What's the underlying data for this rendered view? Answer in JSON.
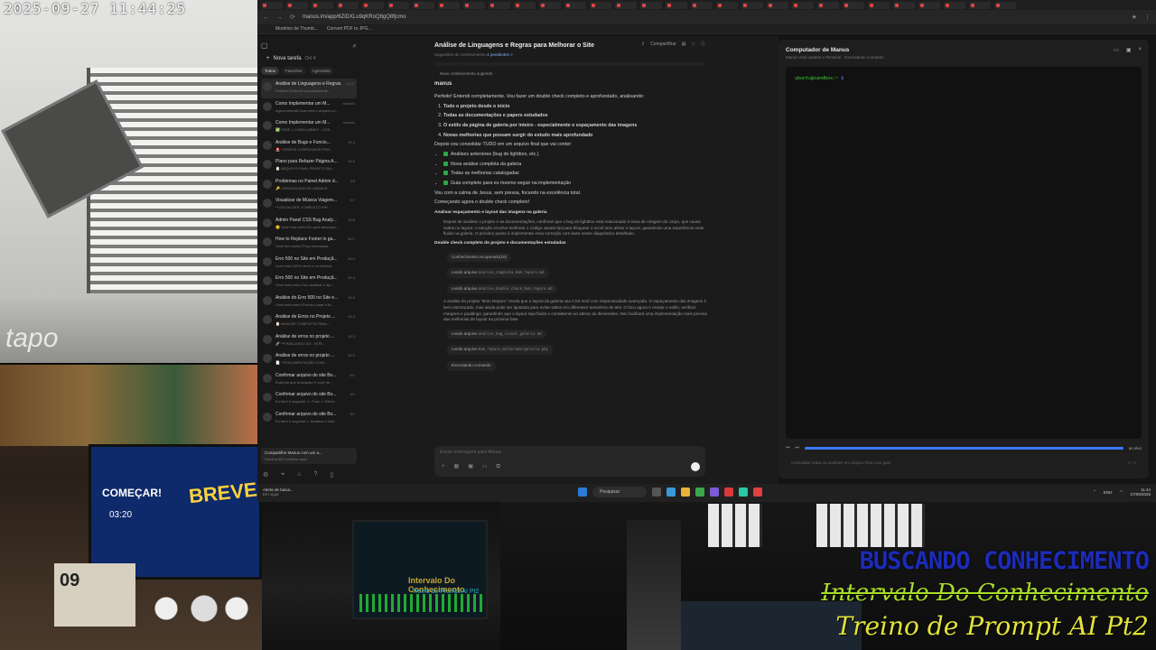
{
  "overlay": {
    "cam_timestamp": "2025-09-27  11:44:25",
    "cam_brand": "tapo",
    "line1": "BUSCANDO CONHECIMENTO",
    "line2": "Intervalo Do Conhecimento",
    "line3": "Treino de Prompt AI Pt2"
  },
  "webcam_monitor": {
    "text_comecar": "COMEÇAR!",
    "text_time": "03:20",
    "text_breve": "BREVE!",
    "calendar_day": "09"
  },
  "studio_monitor": {
    "title": "Intervalo Do Conhecimento",
    "subtitle": "Treino de Prompt AI Pt2"
  },
  "browser": {
    "url": "manus.im/app/6ZiDXLu9qKRoQ8gQ8fjcmo",
    "bookmarks": [
      "Modelos de Thumb...",
      "Convert PDF to JPG..."
    ]
  },
  "sidebar": {
    "new_task": "Nova tarefa",
    "new_task_shortcut": "Ctrl K",
    "filters": [
      "Todos",
      "Favoritos",
      "Agendado"
    ],
    "tasks": [
      {
        "title": "Análise de Linguagens e Regras...",
        "sub": "Perfeito! Entendi completamente...",
        "date": "11:47"
      },
      {
        "title": "Como Implementar um M...",
        "sub": "Agora entendi! Aqui está o arquivo co...",
        "date": "sábado"
      },
      {
        "title": "Como Implementar um M...",
        "sub": "✅ FASE 1 CONCLUÍDA!** - CSS...",
        "date": "sábado"
      },
      {
        "title": "Análise de Bugs e Funcio...",
        "sub": "🚨 **ERROS CORRIGIDOS PRO...",
        "date": "9/13"
      },
      {
        "title": "Plano para Refazer Página A...",
        "sub": "📋 ARQUIVO FINAL PRONTO EM...",
        "date": "9/10"
      },
      {
        "title": "Problemas no Painel Admin d...",
        "sub": "🔑 CREDENCIAIS DE ADMIN E...",
        "date": "9/8"
      },
      {
        "title": "Visualizar de Música Viagem...",
        "sub": "**VISUALIZER COMPLETO FIN...",
        "date": "9/7"
      },
      {
        "title": "Admin Panel CSS Bug Analy...",
        "sub": "😊 Você está certo! Eu pedi desculpa...",
        "date": "9/28"
      },
      {
        "title": "How to Replace Footer in ga...",
        "sub": "Você tem razão! Peço desculpas...",
        "date": "8/27"
      },
      {
        "title": "Erro 500 no Site em Produçã...",
        "sub": "Você está 100% certo e eu entendi...",
        "date": "8/24"
      },
      {
        "title": "Erro 500 no Site em Produçã...",
        "sub": "Você está certo! Vou analisar e aju...",
        "date": "8/14"
      },
      {
        "title": "Análise do Erro 500 no Site e...",
        "sub": "Você está certo! Preciso parar e fa...",
        "date": "8/15"
      },
      {
        "title": "Análise de Erros no Projeto ...",
        "sub": "📋 ANÁLISE COMPLETA FINAL...",
        "date": "8/14"
      },
      {
        "title": "Análise de erros no projeto ...",
        "sub": "🚀 **FINALIZADO 3/3 - NITE...",
        "date": "8/13"
      },
      {
        "title": "Análise de erros no projeto ...",
        "sub": "📄 **DOCUMENTAÇÃO COM...",
        "date": "8/12"
      },
      {
        "title": "Confirmar arquivo do site Bo...",
        "sub": "Entendo que frustração é você de...",
        "date": "8/4"
      },
      {
        "title": "Confirmar arquivo do site Bo...",
        "sub": "Eu farei e seguinte: 1. Fase 1: Estrut...",
        "date": "8/4"
      },
      {
        "title": "Confirmar arquivo do site Bo...",
        "sub": "Eu farei e seguinte 1. Analisar o biuli...",
        "date": "8/4"
      }
    ],
    "share_title": "Compartilhe Manus com um a...",
    "share_sub": "Receba 500 créditos cada"
  },
  "chat": {
    "title": "Análise de Linguagens e Regras para Melhorar o Site",
    "subtitle": "Sugestões de conhecimento",
    "subtitle_badge": "4 pendentes >",
    "share_label": "Compartilhar",
    "knowledge_pill": "Novo conhecimento sugerido",
    "agent_name": "manus",
    "intro": "Perfeito! Entendi completamente. Vou fazer um double check completo e aprofundado, analisando:",
    "ordered": [
      "Todo o projeto desde o início",
      "Todas as documentações e papers estudados",
      "O estilo da página de galeria por inteiro - especialmente o espaçamento das imagens",
      "Novas melhorias que possam surgir do estudo mais aprofundado"
    ],
    "consolidate": "Depois vou consolidar TUDO em um arquivo final que vai conter:",
    "checks": [
      "Análises anteriores (bug do lightbox, etc.)",
      "Nova análise completa da galeria",
      "Todas as melhorias catalogadas",
      "Guia completo para eu mesmo seguir na implementação"
    ],
    "calm": "Vou com a calma de Jesus, sem pressa, focando na excelência total.",
    "start": "Começando agora o double check completo!",
    "step1_title": "Analisar espaçamento e layout das imagens na galeria",
    "step1_body": "Depois de analisar o projeto e as documentações, confirmei que o bug do lightbox está relacionado à trava de rolagem do corpo, que causa saltos no layout. A solução envolve melhorar o código JavaScript para bloquear o scroll sem afetar o layout, garantindo uma experiência mais fluida na galeria. O próximo passo é implementar essa correção com base nesse diagnóstico detalhado.",
    "step2_title": "Double check completo do projeto e documentações estudadas",
    "knowledge_recovered": "Conhecimento recuperado(18)",
    "read1_label": "Lendo arquivo",
    "read1_file": "analise_completa_bom_reparo.md",
    "read2_label": "Lendo arquivo",
    "read2_file": "analise_double_check_bom_reparo.md",
    "step2_body": "A análise do projeto \"Bom Reparo\" revela que o layout da galeria usa CSS Grid com responsividade avançada. O espaçamento das imagens é bem estruturado, mas ainda pode ser ajustado para evitar saltos em diferentes tamanhos de tela. O foco agora é revisar o estilo, verificar margens e paddings, garantindo que o layout seja fluido e consistente ao alterar as dimensões. Isso facilitará uma implementação mais precisa das melhorias de layout na próxima fase.",
    "read3_label": "Lendo arquivo",
    "read3_file": "analise_bug_visual_galeria.md",
    "read4_label": "Lendo arquivo",
    "read4_file": "bom_reparo_melhorado/galeria.php",
    "exec_label": "Executando comando",
    "composer_placeholder": "Enviar mensagem para Manus"
  },
  "computer": {
    "title": "Computador de Manus",
    "subtitle": "Manus está usando o Terminal",
    "subtitle2": "Executando comando",
    "prompt_user": "ubuntu@sandbox:~",
    "prompt_symbol": "$",
    "live_label": "ao vivo",
    "footer": "Consolidar todas as análises em arquivo final com guia",
    "page": "6 / 6"
  },
  "taskbar": {
    "weather_title": "Alerta de baixa...",
    "weather_sub": "Em vigor",
    "search": "Pesquisar",
    "lang": "ENG",
    "time": "11:44",
    "date": "27/09/2025"
  }
}
